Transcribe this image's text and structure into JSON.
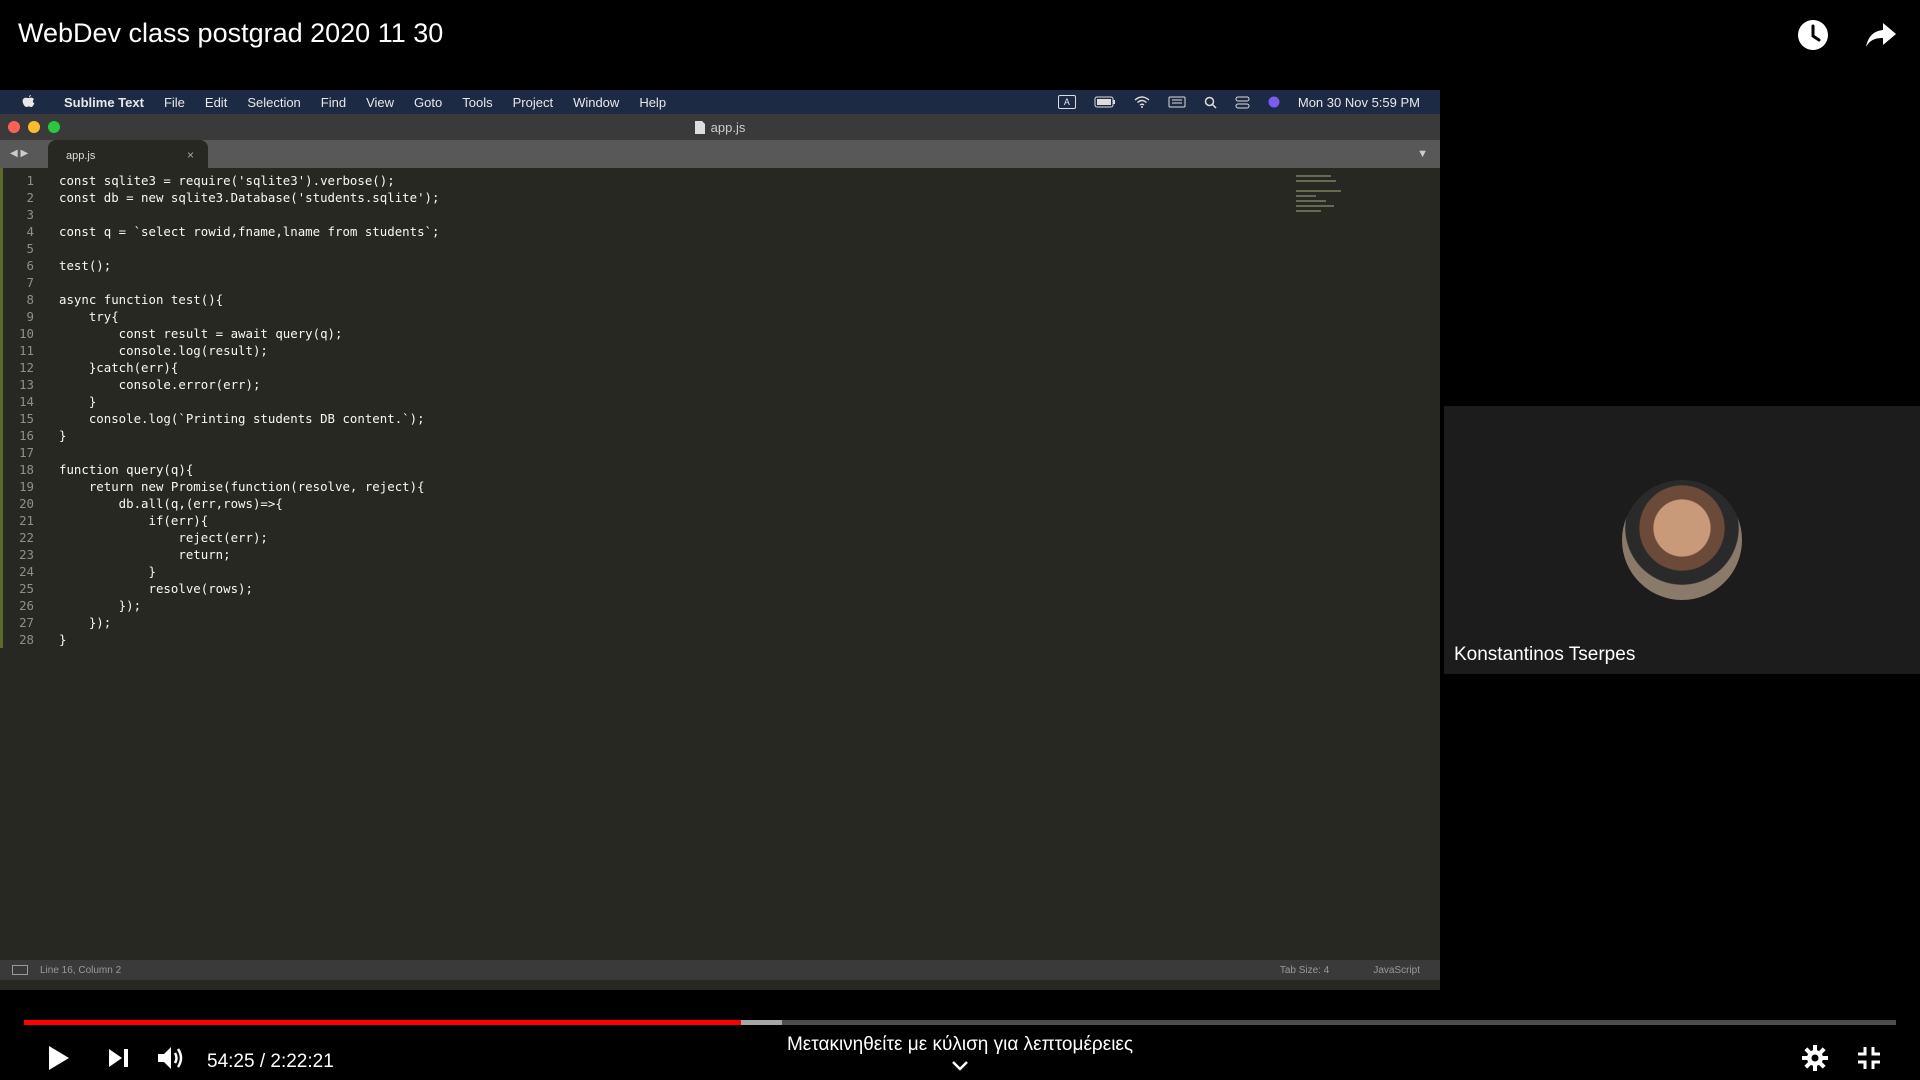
{
  "video": {
    "title": "WebDev class postgrad 2020 11 30",
    "current_time": "54:25",
    "duration": "2:22:21",
    "time_separator": " / ",
    "played_fraction": 0.383,
    "buffered_fraction": 0.405,
    "hint": "Μετακινηθείτε με κύλιση για λεπτομέρειες"
  },
  "mac": {
    "apple": "",
    "menus": [
      "Sublime Text",
      "File",
      "Edit",
      "Selection",
      "Find",
      "View",
      "Goto",
      "Tools",
      "Project",
      "Window",
      "Help"
    ],
    "clock": "Mon 30 Nov  5:59 PM",
    "status_a": "A"
  },
  "editor": {
    "window_title": "app.js",
    "tab_label": "app.js",
    "tab_close": "×",
    "current_line": 16,
    "lines": [
      "const sqlite3 = require('sqlite3').verbose();",
      "const db = new sqlite3.Database('students.sqlite');",
      "",
      "const q = `select rowid,fname,lname from students`;",
      "",
      "test();",
      "",
      "async function test(){",
      "    try{",
      "        const result = await query(q);",
      "        console.log(result);",
      "    }catch(err){",
      "        console.error(err);",
      "    }",
      "    console.log(`Printing students DB content.`);",
      "}",
      "",
      "function query(q){",
      "    return new Promise(function(resolve, reject){",
      "        db.all(q,(err,rows)=>{",
      "            if(err){",
      "                reject(err);",
      "                return;",
      "            }",
      "            resolve(rows);",
      "        });",
      "    });",
      "}"
    ],
    "status_position": "Line 16, Column 2",
    "status_tab_size": "Tab Size: 4",
    "status_syntax": "JavaScript"
  },
  "participant": {
    "name": "Konstantinos Tserpes"
  },
  "colors": {
    "progress_played": "#ff0000",
    "editor_bg": "#272822"
  }
}
